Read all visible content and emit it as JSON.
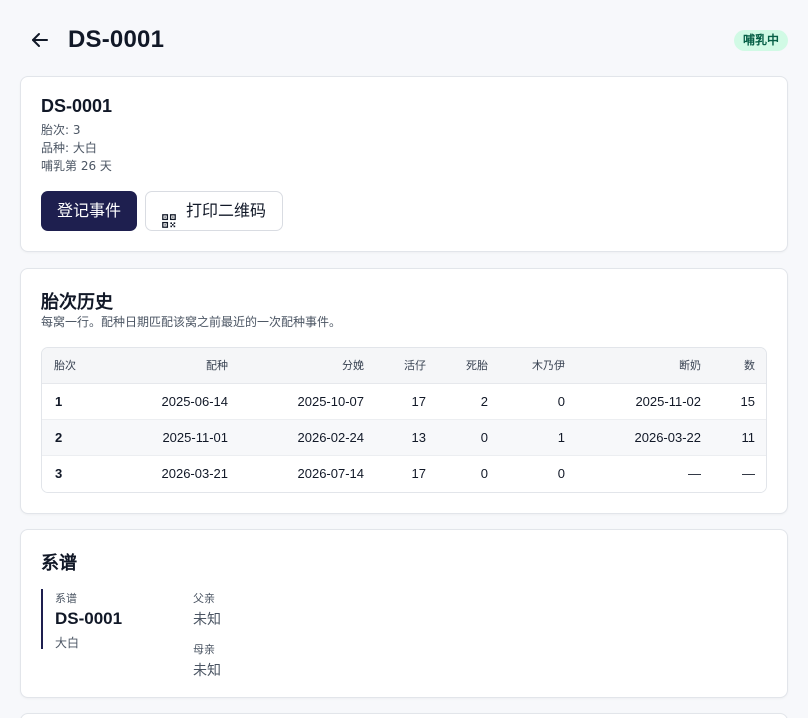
{
  "header": {
    "back_icon": "arrow-left-icon",
    "title": "DS-0001",
    "status": "哺乳中",
    "status_color": "#d1fae5"
  },
  "summary": {
    "id": "DS-0001",
    "parity": "胎次: 3",
    "breed": "品种: 大白",
    "lactation": "哺乳第 26 天",
    "record_button": "登记事件",
    "print_button": "打印二维码",
    "print_icon": "qr-code-icon",
    "primary_color": "#1e1f4f"
  },
  "history": {
    "title": "胎次历史",
    "subtitle": "每窝一行。配种日期匹配该窝之前最近的一次配种事件。",
    "columns": [
      "胎次",
      "配种",
      "分娩",
      "活仔",
      "死胎",
      "木乃伊",
      "断奶",
      "数"
    ],
    "rows": [
      [
        "1",
        "2025-06-14",
        "2025-10-07",
        "17",
        "2",
        "0",
        "2025-11-02",
        "15"
      ],
      [
        "2",
        "2025-11-01",
        "2026-02-24",
        "13",
        "0",
        "1",
        "2026-03-22",
        "11"
      ],
      [
        "3",
        "2026-03-21",
        "2026-07-14",
        "17",
        "0",
        "0",
        "—",
        "—"
      ]
    ]
  },
  "pedigree": {
    "title": "系谱",
    "self_label": "系谱",
    "self_id": "DS-0001",
    "self_breed": "大白",
    "sire_label": "父亲",
    "sire_value": "未知",
    "dam_label": "母亲",
    "dam_value": "未知"
  }
}
